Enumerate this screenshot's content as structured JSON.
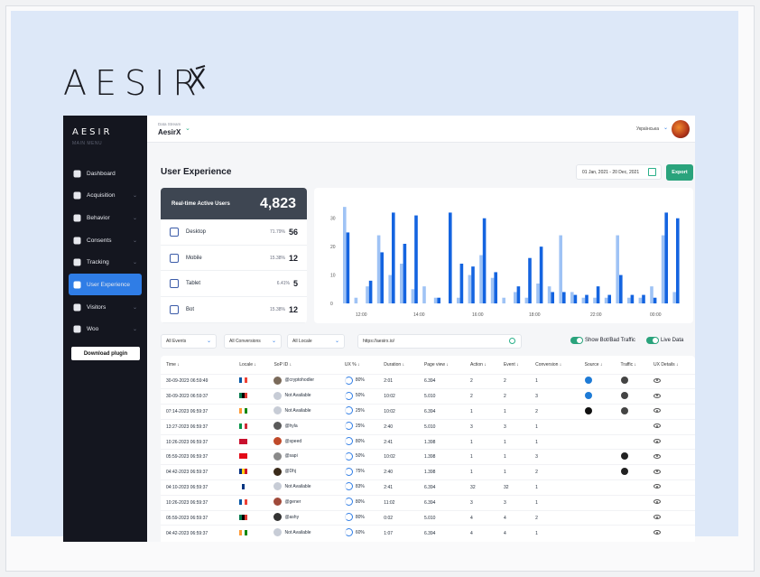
{
  "brand": {
    "logo_text": "AESIR",
    "side_logo": "AESIR",
    "side_subtitle": "MAIN MENU"
  },
  "sidebar": {
    "items": [
      {
        "label": "Dashboard",
        "icon": "dashboard-icon",
        "has_chevron": false,
        "active": false
      },
      {
        "label": "Acquisition",
        "icon": "calendar-icon",
        "has_chevron": true,
        "active": false
      },
      {
        "label": "Behavior",
        "icon": "flow-icon",
        "has_chevron": true,
        "active": false
      },
      {
        "label": "Consents",
        "icon": "gear-icon",
        "has_chevron": true,
        "active": false
      },
      {
        "label": "Tracking",
        "icon": "target-icon",
        "has_chevron": true,
        "active": false
      },
      {
        "label": "User Experience",
        "icon": "smile-icon",
        "has_chevron": false,
        "active": true
      },
      {
        "label": "Visitors",
        "icon": "compass-icon",
        "has_chevron": true,
        "active": false
      },
      {
        "label": "Woo",
        "icon": "woo-icon",
        "has_chevron": true,
        "active": false
      }
    ],
    "download_label": "Download plugin"
  },
  "topbar": {
    "data_stream_label": "Data Stream",
    "data_stream_value": "AesirX",
    "language": "Українська"
  },
  "page": {
    "title": "User Experience",
    "date_range": "01 Jan, 2021 - 20 Dec, 2021",
    "export_label": "Export"
  },
  "realtime": {
    "title": "Real-time Active Users",
    "value": "4,823",
    "devices": [
      {
        "name": "Desktop",
        "pct": "71.79%",
        "count": "56"
      },
      {
        "name": "Mobile",
        "pct": "15.38%",
        "count": "12"
      },
      {
        "name": "Tablet",
        "pct": "6.41%",
        "count": "5"
      },
      {
        "name": "Bot",
        "pct": "15.38%",
        "count": "12"
      }
    ]
  },
  "chart_data": {
    "type": "bar",
    "x_tick_labels": [
      "12:00",
      "14:00",
      "16:00",
      "18:00",
      "22:00",
      "00:00"
    ],
    "y_tick_labels": [
      "0",
      "10",
      "20",
      "30"
    ],
    "ylim": [
      0,
      35
    ],
    "colors": {
      "light": "#9fc3f5",
      "dark": "#1464e0"
    },
    "series": [
      {
        "values": [
          34,
          2,
          6,
          24,
          10,
          14,
          5,
          6,
          2,
          0,
          2,
          10,
          17,
          9,
          2,
          4,
          2,
          7,
          6,
          24,
          4,
          2,
          2,
          2,
          24,
          2,
          2,
          6,
          24,
          4
        ]
      },
      {
        "values": [
          25,
          0,
          8,
          18,
          32,
          21,
          31,
          0,
          2,
          32,
          14,
          13,
          30,
          11,
          0,
          6,
          16,
          20,
          4,
          4,
          3,
          3,
          6,
          3,
          10,
          3,
          3,
          2,
          32,
          30
        ]
      }
    ]
  },
  "filters": {
    "events": "All Events",
    "conversions": "All Conversions",
    "locale": "All Locale",
    "url": "https://aesirx.io/",
    "toggle_bot": "Show Bot/Bad Traffic",
    "toggle_live": "Live Data"
  },
  "table": {
    "headers": [
      "Time ↓",
      "Locale ↓",
      "SoP ID ↓",
      "UX % ↓",
      "Duration ↓",
      "Page view ↓",
      "Action ↓",
      "Event ↓",
      "Conversion ↓",
      "Source ↓",
      "Traffic ↓",
      "UX Details ↓"
    ],
    "rows": [
      {
        "time": "30-09-2023 06:59:49",
        "sop": "@cryptohodler",
        "ux": "80%",
        "duration": "2:01",
        "pageview": "6.394",
        "action": "2",
        "event": "2",
        "conversion": "1",
        "flag": [
          "#0055a4",
          "#fff",
          "#ef4135"
        ],
        "source": "#1e7bd6",
        "traffic": "#444"
      },
      {
        "time": "30-09-2023 06:59:37",
        "sop": "Not Available",
        "ux": "50%",
        "duration": "10:02",
        "pageview": "5.010",
        "action": "2",
        "event": "2",
        "conversion": "3",
        "flag": [
          "#007a4d",
          "#000",
          "#de3831"
        ],
        "source": "#1e7bd6",
        "traffic": "#444"
      },
      {
        "time": "07:14-2023 06:59:37",
        "sop": "Not Available",
        "ux": "25%",
        "duration": "10:02",
        "pageview": "6.394",
        "action": "1",
        "event": "1",
        "conversion": "2",
        "flag": [
          "#ff9933",
          "#fff",
          "#138808"
        ],
        "source": "#111",
        "traffic": "#444"
      },
      {
        "time": "13:27-2023 06:59:37",
        "sop": "@hyla",
        "ux": "25%",
        "duration": "2:40",
        "pageview": "5.010",
        "action": "3",
        "event": "3",
        "conversion": "1",
        "flag": [
          "#009246",
          "#fff",
          "#ce2b37"
        ],
        "source": "",
        "traffic": ""
      },
      {
        "time": "10:26-2023 06:59:37",
        "sop": "@speed",
        "ux": "80%",
        "duration": "2:41",
        "pageview": "1.398",
        "action": "1",
        "event": "1",
        "conversion": "1",
        "flag": [
          "#c8102e",
          "#c8102e",
          "#c8102e"
        ],
        "source": "",
        "traffic": ""
      },
      {
        "time": "05:59-2023 06:59:37",
        "sop": "@sapi",
        "ux": "50%",
        "duration": "10:02",
        "pageview": "1.398",
        "action": "1",
        "event": "1",
        "conversion": "3",
        "flag": [
          "#e30a17",
          "#e30a17",
          "#e30a17"
        ],
        "source": "",
        "traffic": "#222"
      },
      {
        "time": "04:42-2023 06:59:37",
        "sop": "@Dhj",
        "ux": "75%",
        "duration": "2:40",
        "pageview": "1.398",
        "action": "1",
        "event": "1",
        "conversion": "2",
        "flag": [
          "#002b7f",
          "#fcd116",
          "#ce1126"
        ],
        "source": "",
        "traffic": "#222"
      },
      {
        "time": "04:10-2023 06:59:37",
        "sop": "Not Available",
        "ux": "83%",
        "duration": "2:41",
        "pageview": "6.394",
        "action": "32",
        "event": "32",
        "conversion": "1",
        "flag": [
          "#fff",
          "#003580",
          "#fff"
        ],
        "source": "",
        "traffic": ""
      },
      {
        "time": "10:26-2023 06:59:37",
        "sop": "@gener",
        "ux": "80%",
        "duration": "11:02",
        "pageview": "6.394",
        "action": "3",
        "event": "3",
        "conversion": "1",
        "flag": [
          "#0055a4",
          "#fff",
          "#ef4135"
        ],
        "source": "",
        "traffic": ""
      },
      {
        "time": "05:59-2023 06:59:37",
        "sop": "@ashy",
        "ux": "80%",
        "duration": "0:02",
        "pageview": "5.010",
        "action": "4",
        "event": "4",
        "conversion": "2",
        "flag": [
          "#007a4d",
          "#000",
          "#de3831"
        ],
        "source": "",
        "traffic": ""
      },
      {
        "time": "04:42-2023 06:59:37",
        "sop": "Not Available",
        "ux": "60%",
        "duration": "1:07",
        "pageview": "6.394",
        "action": "4",
        "event": "4",
        "conversion": "1",
        "flag": [
          "#ff9933",
          "#fff",
          "#138808"
        ],
        "source": "",
        "traffic": ""
      }
    ]
  }
}
